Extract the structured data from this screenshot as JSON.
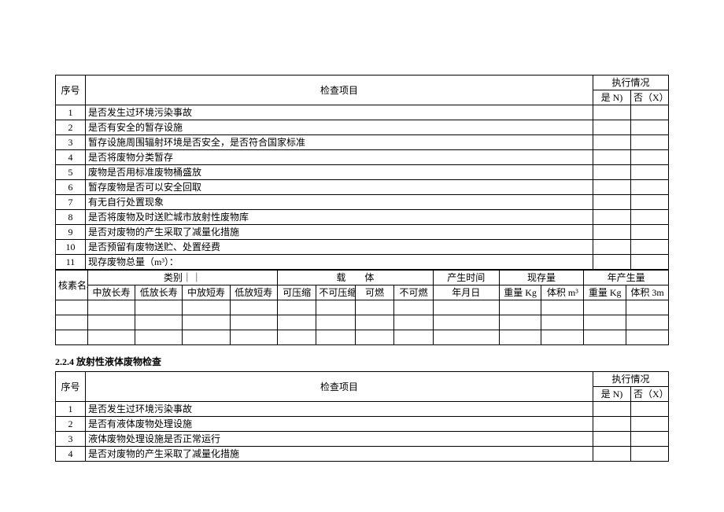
{
  "table1": {
    "headers": {
      "no": "序号",
      "item": "检查项目",
      "exec": "执行情况",
      "yes": "是 N)",
      "no_col": "否（X）"
    },
    "rows": [
      {
        "no": "1",
        "item": "是否发生过环境污染事故"
      },
      {
        "no": "2",
        "item": "是否有安全的暂存设施"
      },
      {
        "no": "3",
        "item": "暂存设施周围辐射环境是否安全，是否符合国家标准"
      },
      {
        "no": "4",
        "item": "是否将废物分类暂存"
      },
      {
        "no": "5",
        "item": "废物是否用标准废物桶盛放"
      },
      {
        "no": "6",
        "item": "暂存废物是否可以安全回取"
      },
      {
        "no": "7",
        "item": "有无自行处置现象"
      },
      {
        "no": "8",
        "item": "是否将废物及时送贮城市放射性废物库"
      },
      {
        "no": "9",
        "item": "是否对废物的产生采取了减量化措施"
      },
      {
        "no": "10",
        "item": "是否预留有废物送贮、处置经费"
      },
      {
        "no": "11",
        "item": "现存废物总量（m³）："
      }
    ]
  },
  "table_mid": {
    "headers": {
      "nuclide": "核素名称",
      "category": "类别｜｜",
      "cat_sub": [
        "中放长寿",
        "低放长寿",
        "中放短寿",
        "低放短寿"
      ],
      "carrier": "载　　体",
      "carrier_sub": [
        "可压缩",
        "不可压缩",
        "可燃",
        "不可燃"
      ],
      "time": "产生时间",
      "time_sub": "年月日",
      "stock": "现存量",
      "stock_sub": [
        "重量 Kg",
        "体积 m³"
      ],
      "annual": "年产生量",
      "annual_sub": [
        "重量 Kg",
        "体积 3m"
      ]
    }
  },
  "section224": "2.2.4 放射性液体废物检查",
  "table2": {
    "headers": {
      "no": "序号",
      "item": "检查项目",
      "exec": "执行情况",
      "yes": "是 N)",
      "no_col": "否（X）"
    },
    "rows": [
      {
        "no": "1",
        "item": "是否发生过环境污染事故"
      },
      {
        "no": "2",
        "item": "是否有液体废物处理设施"
      },
      {
        "no": "3",
        "item": "液体废物处理设施是否正常运行"
      },
      {
        "no": "4",
        "item": "是否对废物的产生采取了减量化措施"
      }
    ]
  }
}
